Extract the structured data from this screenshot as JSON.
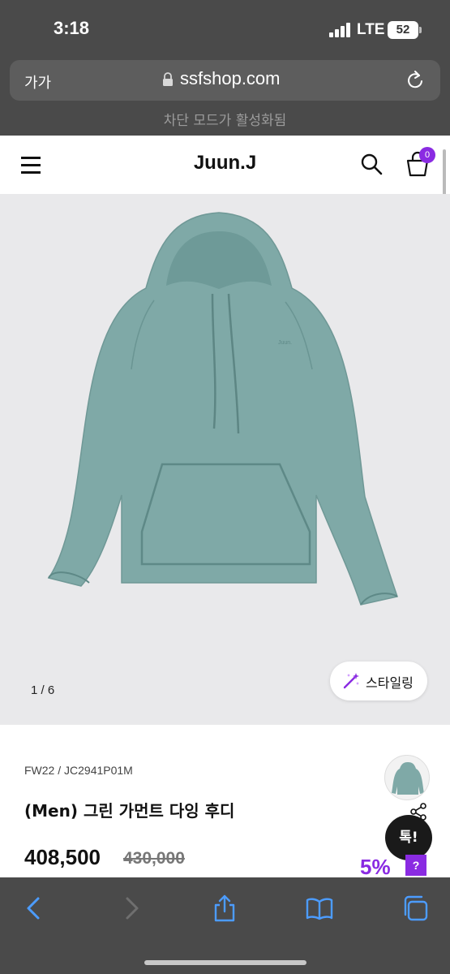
{
  "status_bar": {
    "time": "3:18",
    "network": "LTE",
    "battery": "52"
  },
  "browser": {
    "aa_label": "가가",
    "url": "ssfshop.com",
    "block_mode": "차단 모드가 활성화됨"
  },
  "site": {
    "brand": "Juun.J",
    "cart_count": "0"
  },
  "gallery": {
    "page_indicator": "1 / 6",
    "style_button": "스타일링"
  },
  "product": {
    "code": "FW22 / JC2941P01M",
    "name": "(Men) 그린 가먼트 다잉 후디",
    "price": "408,500",
    "original_price": "430,000",
    "discount": "5%",
    "help": "?",
    "talk_button": "톡!"
  },
  "colors": {
    "accent": "#8a2be2",
    "ios_blue": "#4c9cff",
    "hoodie": "#7fa9a7"
  },
  "icons": [
    "signal-icon",
    "lock-icon",
    "reload-icon",
    "menu-icon",
    "search-icon",
    "cart-icon",
    "wand-icon",
    "share-icon",
    "back-icon",
    "forward-icon",
    "share-sheet-icon",
    "bookmarks-icon",
    "tabs-icon"
  ]
}
